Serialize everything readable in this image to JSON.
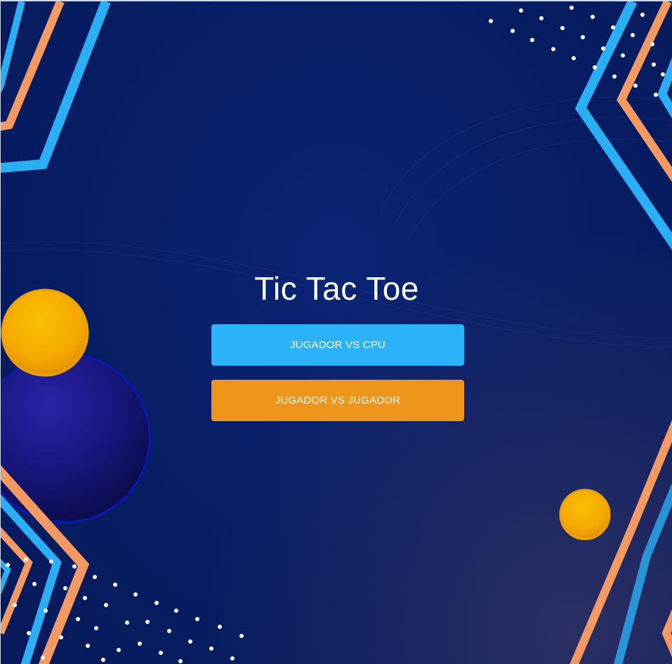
{
  "page": {
    "title": "Tic Tac Toe"
  },
  "menu": {
    "vs_cpu_label": "JUGADOR VS CPU",
    "vs_player_label": "JUGADOR VS JUGADOR"
  },
  "colors": {
    "background": "#071d63",
    "cpu_button": "#2bb2f9",
    "player_button": "#ee951c",
    "accent_orange": "#f5a055",
    "accent_blue": "#2aaff5",
    "ball_yellow": "#f6b400",
    "ball_navy": "#1b1a8a"
  }
}
